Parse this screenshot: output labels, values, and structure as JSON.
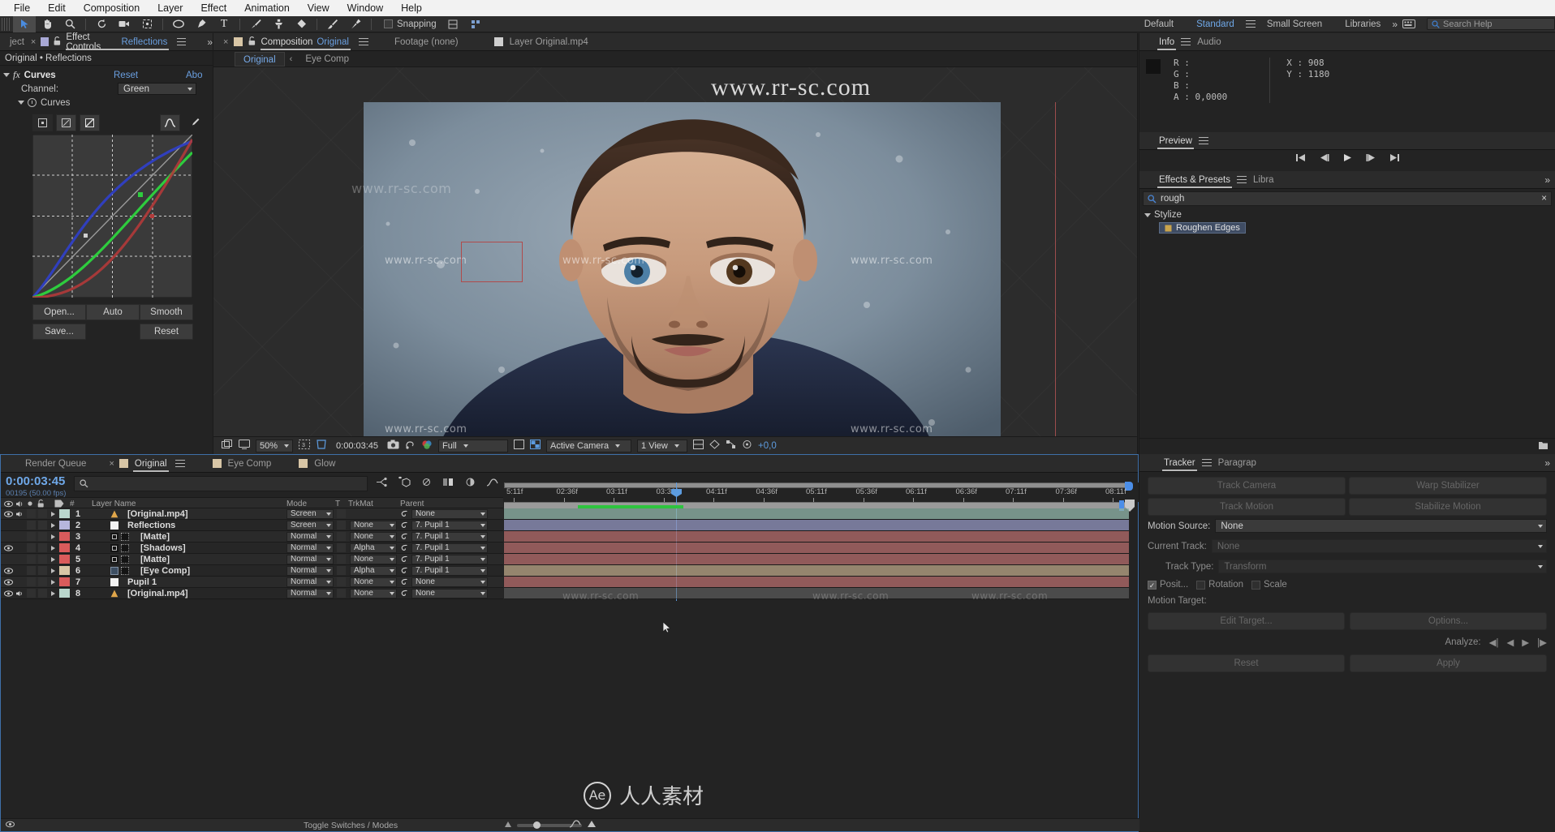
{
  "menu": {
    "items": [
      "File",
      "Edit",
      "Composition",
      "Layer",
      "Effect",
      "Animation",
      "View",
      "Window",
      "Help"
    ]
  },
  "toolbar": {
    "snapping_label": "Snapping",
    "workspaces": [
      "Default",
      "Standard",
      "Small Screen",
      "Libraries"
    ],
    "active_workspace": "Standard",
    "search_help_placeholder": "Search Help",
    "tools": [
      "selection-tool",
      "hand-tool",
      "zoom-tool",
      "rotation-tool",
      "camera-tool",
      "pan-behind-tool",
      "shape-tool",
      "pen-tool",
      "type-tool",
      "brush-tool",
      "clone-stamp-tool",
      "eraser-tool",
      "roto-brush-tool",
      "puppet-pin-tool"
    ]
  },
  "effect_controls": {
    "tab_label": "Effect Controls",
    "tab_target": "Reflections",
    "project_tab": "ject",
    "breadcrumb": "Original • Reflections",
    "effect_name": "Curves",
    "reset_label": "Reset",
    "about_label": "Abo",
    "channel_label": "Channel:",
    "channel_value": "Green",
    "curves_group": "Curves",
    "buttons": [
      "Open...",
      "Auto",
      "Smooth",
      "Save...",
      "",
      "Reset"
    ],
    "open_label": "Open...",
    "auto_label": "Auto",
    "smooth_label": "Smooth",
    "save_label": "Save...",
    "reset2_label": "Reset"
  },
  "composition": {
    "tab_label": "Composition",
    "tab_target": "Original",
    "footage_tab": "Footage (none)",
    "layer_tab": "Layer Original.mp4",
    "view_tabs": [
      "Original",
      "Eye Comp"
    ],
    "active_view_tab": "Original",
    "zoom": "50%",
    "timecode": "0:00:03:45",
    "resolution": "Full",
    "camera": "Active Camera",
    "views": "1 View",
    "offset": "+0,0",
    "watermark_big": "www.rr-sc.com",
    "watermark_small": "www.rr-sc.com"
  },
  "info": {
    "tab_label": "Info",
    "audio_tab": "Audio",
    "r": "R :",
    "g": "G :",
    "b": "B :",
    "a": "A : 0,0000",
    "x": "X : 908",
    "y": "Y : 1180"
  },
  "preview": {
    "tab_label": "Preview",
    "buttons": [
      "first-frame",
      "prev-frame",
      "play",
      "next-frame",
      "last-frame"
    ]
  },
  "effects_presets": {
    "tab_label": "Effects & Presets",
    "other_tab": "Libra",
    "search_value": "rough",
    "category": "Stylize",
    "item": "Roughen Edges"
  },
  "tracker": {
    "tab_label": "Tracker",
    "other_tab": "Paragrap",
    "track_camera": "Track Camera",
    "warp_stabilizer": "Warp Stabilizer",
    "track_motion": "Track Motion",
    "stabilize_motion": "Stabilize Motion",
    "motion_source_label": "Motion Source:",
    "motion_source_value": "None",
    "current_track_label": "Current Track:",
    "current_track_value": "None",
    "track_type_label": "Track Type:",
    "track_type_value": "Transform",
    "position_label": "Posit...",
    "rotation_label": "Rotation",
    "scale_label": "Scale",
    "motion_target_label": "Motion Target:",
    "edit_target": "Edit Target...",
    "options": "Options...",
    "analyze_label": "Analyze:",
    "reset_label": "Reset",
    "apply_label": "Apply"
  },
  "timeline": {
    "tabs": [
      "Render Queue",
      "Original",
      "Eye Comp",
      "Glow"
    ],
    "active_tab": "Original",
    "timecode": "0:00:03:45",
    "frames": "00195 (50.00 fps)",
    "columns": [
      "#",
      "Layer Name",
      "Mode",
      "T",
      "TrkMat",
      "Parent"
    ],
    "toggle_switches": "Toggle Switches / Modes",
    "ruler_ticks": [
      "5:11f",
      "02:36f",
      "03:11f",
      "03:36f",
      "04:11f",
      "04:36f",
      "05:11f",
      "05:36f",
      "06:11f",
      "06:36f",
      "07:11f",
      "07:36f",
      "08:11f"
    ],
    "layers": [
      {
        "num": "1",
        "name": "[Original.mp4]",
        "mode": "Screen",
        "trkmat": "",
        "parent": "None",
        "color": "#b9d6cc",
        "eye": true,
        "audio": true,
        "type": "video"
      },
      {
        "num": "2",
        "name": "Reflections",
        "mode": "Screen",
        "trkmat": "None",
        "parent": "7. Pupil 1",
        "color": "#b6b6dd",
        "eye": false,
        "audio": false,
        "type": "solid"
      },
      {
        "num": "3",
        "name": "[Matte]",
        "mode": "Normal",
        "trkmat": "None",
        "parent": "7. Pupil 1",
        "color": "#d95b5b",
        "eye": false,
        "audio": false,
        "type": "matte"
      },
      {
        "num": "4",
        "name": "[Shadows]",
        "mode": "Normal",
        "trkmat": "Alpha",
        "parent": "7. Pupil 1",
        "color": "#d95b5b",
        "eye": true,
        "audio": false,
        "type": "matte"
      },
      {
        "num": "5",
        "name": "[Matte]",
        "mode": "Normal",
        "trkmat": "None",
        "parent": "7. Pupil 1",
        "color": "#d95b5b",
        "eye": false,
        "audio": false,
        "type": "matte"
      },
      {
        "num": "6",
        "name": "[Eye Comp]",
        "mode": "Normal",
        "trkmat": "Alpha",
        "parent": "7. Pupil 1",
        "color": "#d8c6a6",
        "eye": true,
        "audio": false,
        "type": "comp"
      },
      {
        "num": "7",
        "name": "Pupil 1",
        "mode": "Normal",
        "trkmat": "None",
        "parent": "None",
        "color": "#d95b5b",
        "eye": true,
        "audio": false,
        "type": "solid"
      },
      {
        "num": "8",
        "name": "[Original.mp4]",
        "mode": "Normal",
        "trkmat": "None",
        "parent": "None",
        "color": "#b9d6cc",
        "eye": true,
        "audio": true,
        "type": "video"
      }
    ],
    "track_bar_colors": [
      "#8fb3a8",
      "#8f92bb",
      "#b06a6a",
      "#b06a6a",
      "#b06a6a",
      "#b5a183",
      "#b06a6a",
      "#6d6d6d"
    ],
    "watermark": "www.rr-sc.com"
  },
  "colors": {
    "accent_blue": "#6fa8e8",
    "panel_bg": "#232323",
    "tab_bg": "#2b2b2b",
    "red_guide": "#9d4d4d",
    "curve_red": "#b33a3a",
    "curve_green": "#2ecc3e",
    "curve_blue": "#2f3fc4"
  }
}
